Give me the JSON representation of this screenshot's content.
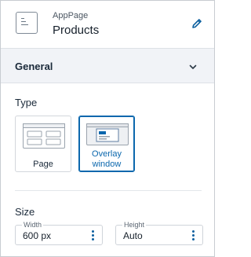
{
  "header": {
    "subtitle": "AppPage",
    "title": "Products",
    "app_icon": "page-icon",
    "edit_icon": "pencil-icon"
  },
  "section": {
    "label": "General",
    "toggle_icon": "chevron-down-icon"
  },
  "type": {
    "label": "Type",
    "options": [
      {
        "label": "Page",
        "selected": false,
        "icon": "page-layout-icon"
      },
      {
        "label": "Overlay window",
        "selected": true,
        "icon": "overlay-window-icon"
      }
    ]
  },
  "size": {
    "label": "Size",
    "width": {
      "label": "Width",
      "value": "600 px"
    },
    "height": {
      "label": "Height",
      "value": "Auto"
    },
    "menu_icon": "kebab-menu-icon"
  },
  "colors": {
    "accent": "#0b67ad",
    "section_bg": "#f1f3f7"
  }
}
